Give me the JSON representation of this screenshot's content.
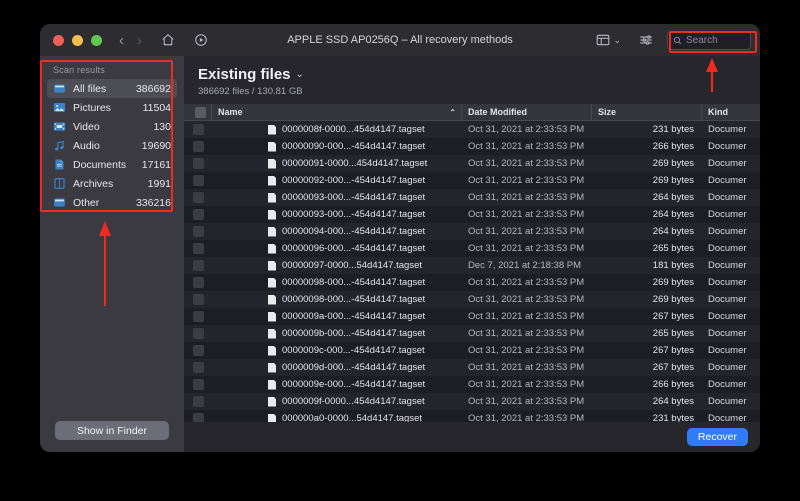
{
  "window": {
    "title": "APPLE SSD AP0256Q – All recovery methods",
    "traffic_lights": [
      "close",
      "minimize",
      "zoom"
    ],
    "nav_back": "‹",
    "nav_forward": "›",
    "home_icon": "home-icon",
    "scan_icon": "play-circle-icon",
    "view_icon": "view-mode-icon",
    "view_caret": "⌄",
    "filter_icon": "filter-sliders-icon"
  },
  "search": {
    "icon": "search-icon",
    "placeholder": "Search",
    "value": ""
  },
  "sidebar": {
    "header": "Scan results",
    "items": [
      {
        "label": "All files",
        "count": "386692",
        "icon": "all-files-icon",
        "active": true
      },
      {
        "label": "Pictures",
        "count": "11504",
        "icon": "pictures-icon",
        "active": false
      },
      {
        "label": "Video",
        "count": "130",
        "icon": "video-icon",
        "active": false
      },
      {
        "label": "Audio",
        "count": "19690",
        "icon": "audio-icon",
        "active": false
      },
      {
        "label": "Documents",
        "count": "17161",
        "icon": "documents-icon",
        "active": false
      },
      {
        "label": "Archives",
        "count": "1991",
        "icon": "archives-icon",
        "active": false
      },
      {
        "label": "Other",
        "count": "336216",
        "icon": "other-icon",
        "active": false
      }
    ],
    "show_in_finder": "Show in Finder"
  },
  "main": {
    "title": "Existing files",
    "title_caret": "⌄",
    "summary": "386692 files / 130.81 GB",
    "columns": [
      {
        "key": "check",
        "label": ""
      },
      {
        "key": "name",
        "label": "Name"
      },
      {
        "key": "date",
        "label": "Date Modified"
      },
      {
        "key": "size",
        "label": "Size"
      },
      {
        "key": "kind",
        "label": "Kind"
      }
    ],
    "sort_indicator": "⌃",
    "rows": [
      {
        "name": "0000008f-0000...454d4147.tagset",
        "date": "Oct 31, 2021 at 2:33:53 PM",
        "size": "231 bytes",
        "kind": "Documer"
      },
      {
        "name": "00000090-000...-454d4147.tagset",
        "date": "Oct 31, 2021 at 2:33:53 PM",
        "size": "266 bytes",
        "kind": "Documer"
      },
      {
        "name": "00000091-0000...454d4147.tagset",
        "date": "Oct 31, 2021 at 2:33:53 PM",
        "size": "269 bytes",
        "kind": "Documer"
      },
      {
        "name": "00000092-000...-454d4147.tagset",
        "date": "Oct 31, 2021 at 2:33:53 PM",
        "size": "269 bytes",
        "kind": "Documer"
      },
      {
        "name": "00000093-000...-454d4147.tagset",
        "date": "Oct 31, 2021 at 2:33:53 PM",
        "size": "264 bytes",
        "kind": "Documer"
      },
      {
        "name": "00000093-000...-454d4147.tagset",
        "date": "Oct 31, 2021 at 2:33:53 PM",
        "size": "264 bytes",
        "kind": "Documer"
      },
      {
        "name": "00000094-000...-454d4147.tagset",
        "date": "Oct 31, 2021 at 2:33:53 PM",
        "size": "264 bytes",
        "kind": "Documer"
      },
      {
        "name": "00000096-000...-454d4147.tagset",
        "date": "Oct 31, 2021 at 2:33:53 PM",
        "size": "265 bytes",
        "kind": "Documer"
      },
      {
        "name": "00000097-0000...54d4147.tagset",
        "date": "Dec 7, 2021 at 2:18:38 PM",
        "size": "181 bytes",
        "kind": "Documer"
      },
      {
        "name": "00000098-000...-454d4147.tagset",
        "date": "Oct 31, 2021 at 2:33:53 PM",
        "size": "269 bytes",
        "kind": "Documer"
      },
      {
        "name": "00000098-000...-454d4147.tagset",
        "date": "Oct 31, 2021 at 2:33:53 PM",
        "size": "269 bytes",
        "kind": "Documer"
      },
      {
        "name": "0000009a-000...-454d4147.tagset",
        "date": "Oct 31, 2021 at 2:33:53 PM",
        "size": "267 bytes",
        "kind": "Documer"
      },
      {
        "name": "0000009b-000...-454d4147.tagset",
        "date": "Oct 31, 2021 at 2:33:53 PM",
        "size": "265 bytes",
        "kind": "Documer"
      },
      {
        "name": "0000009c-000...-454d4147.tagset",
        "date": "Oct 31, 2021 at 2:33:53 PM",
        "size": "267 bytes",
        "kind": "Documer"
      },
      {
        "name": "0000009d-000...-454d4147.tagset",
        "date": "Oct 31, 2021 at 2:33:53 PM",
        "size": "267 bytes",
        "kind": "Documer"
      },
      {
        "name": "0000009e-000...-454d4147.tagset",
        "date": "Oct 31, 2021 at 2:33:53 PM",
        "size": "266 bytes",
        "kind": "Documer"
      },
      {
        "name": "0000009f-0000...454d4147.tagset",
        "date": "Oct 31, 2021 at 2:33:53 PM",
        "size": "264 bytes",
        "kind": "Documer"
      },
      {
        "name": "000000a0-0000...54d4147.tagset",
        "date": "Oct 31, 2021 at 2:33:53 PM",
        "size": "231 bytes",
        "kind": "Documer"
      }
    ],
    "recover_button": "Recover"
  },
  "annotations": {
    "color": "#ee2b20",
    "highlight_sidebar": "scan-results-panel",
    "highlight_search": "search-field",
    "arrow_sidebar": "arrow-up",
    "arrow_search": "arrow-up"
  },
  "colors": {
    "accent_blue": "#2f7cf6",
    "icon_blue": "#3b82c4",
    "annotation_red": "#ee2b20",
    "window_bg": "#2b2b30",
    "sidebar_bg": "#3a3a40",
    "list_bg": "#1f1f26"
  }
}
